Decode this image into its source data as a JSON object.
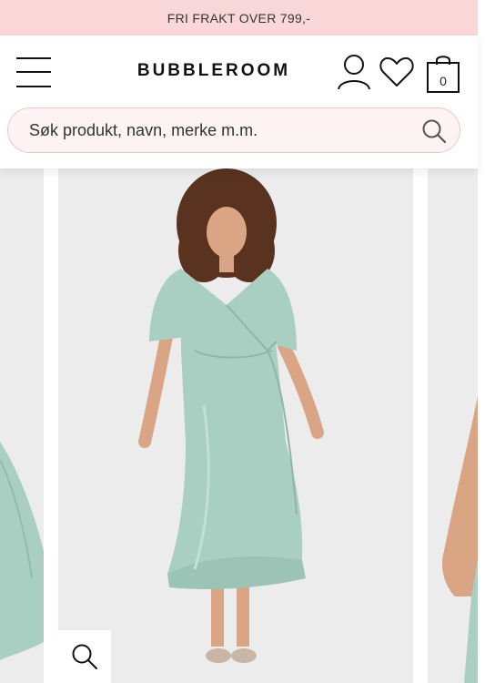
{
  "banner": {
    "text": "FRI FRAKT OVER 799,-"
  },
  "header": {
    "logo": "BUBBLEROOM",
    "cart_count": "0"
  },
  "search": {
    "placeholder": "Søk produkt, navn, merke m.m."
  },
  "product": {
    "dress_color": "#a9cfc2",
    "background_color": "#ececec"
  },
  "icons": [
    "menu-icon",
    "user-icon",
    "heart-icon",
    "cart-icon",
    "search-icon",
    "zoom-icon"
  ]
}
